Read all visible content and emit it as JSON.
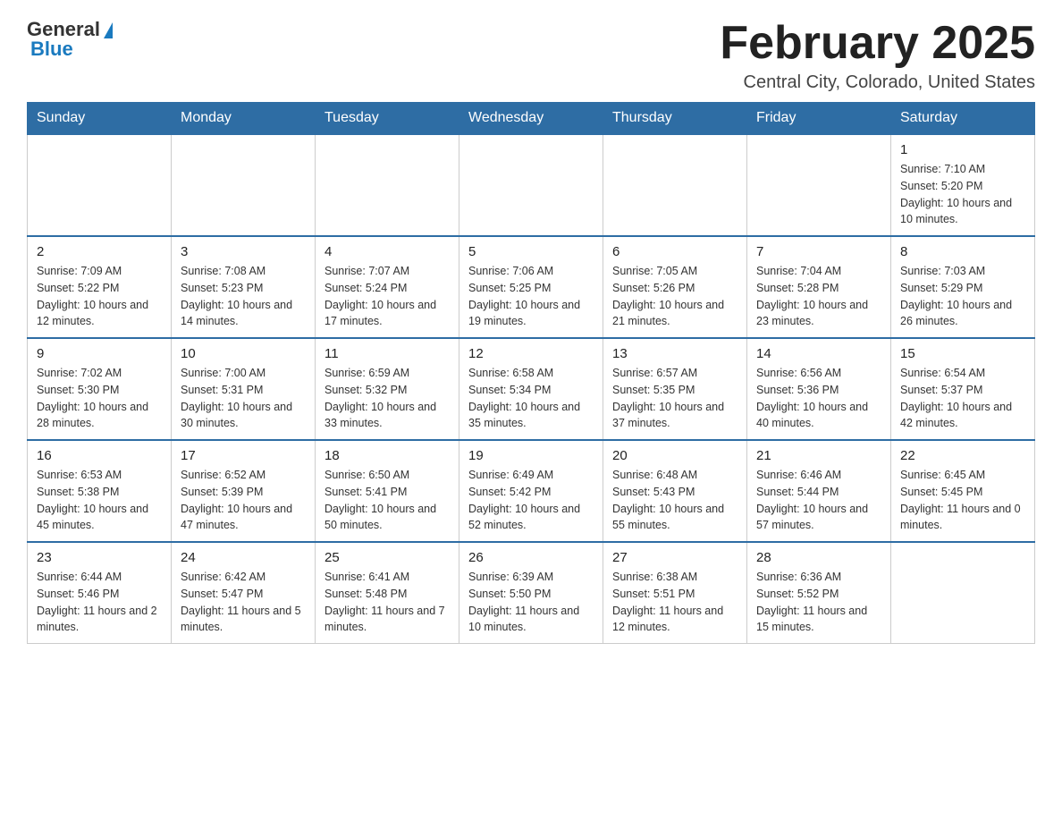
{
  "header": {
    "logo_general": "General",
    "logo_blue": "Blue",
    "month_title": "February 2025",
    "location": "Central City, Colorado, United States"
  },
  "days_of_week": [
    "Sunday",
    "Monday",
    "Tuesday",
    "Wednesday",
    "Thursday",
    "Friday",
    "Saturday"
  ],
  "weeks": [
    [
      {
        "day": "",
        "info": ""
      },
      {
        "day": "",
        "info": ""
      },
      {
        "day": "",
        "info": ""
      },
      {
        "day": "",
        "info": ""
      },
      {
        "day": "",
        "info": ""
      },
      {
        "day": "",
        "info": ""
      },
      {
        "day": "1",
        "info": "Sunrise: 7:10 AM\nSunset: 5:20 PM\nDaylight: 10 hours and 10 minutes."
      }
    ],
    [
      {
        "day": "2",
        "info": "Sunrise: 7:09 AM\nSunset: 5:22 PM\nDaylight: 10 hours and 12 minutes."
      },
      {
        "day": "3",
        "info": "Sunrise: 7:08 AM\nSunset: 5:23 PM\nDaylight: 10 hours and 14 minutes."
      },
      {
        "day": "4",
        "info": "Sunrise: 7:07 AM\nSunset: 5:24 PM\nDaylight: 10 hours and 17 minutes."
      },
      {
        "day": "5",
        "info": "Sunrise: 7:06 AM\nSunset: 5:25 PM\nDaylight: 10 hours and 19 minutes."
      },
      {
        "day": "6",
        "info": "Sunrise: 7:05 AM\nSunset: 5:26 PM\nDaylight: 10 hours and 21 minutes."
      },
      {
        "day": "7",
        "info": "Sunrise: 7:04 AM\nSunset: 5:28 PM\nDaylight: 10 hours and 23 minutes."
      },
      {
        "day": "8",
        "info": "Sunrise: 7:03 AM\nSunset: 5:29 PM\nDaylight: 10 hours and 26 minutes."
      }
    ],
    [
      {
        "day": "9",
        "info": "Sunrise: 7:02 AM\nSunset: 5:30 PM\nDaylight: 10 hours and 28 minutes."
      },
      {
        "day": "10",
        "info": "Sunrise: 7:00 AM\nSunset: 5:31 PM\nDaylight: 10 hours and 30 minutes."
      },
      {
        "day": "11",
        "info": "Sunrise: 6:59 AM\nSunset: 5:32 PM\nDaylight: 10 hours and 33 minutes."
      },
      {
        "day": "12",
        "info": "Sunrise: 6:58 AM\nSunset: 5:34 PM\nDaylight: 10 hours and 35 minutes."
      },
      {
        "day": "13",
        "info": "Sunrise: 6:57 AM\nSunset: 5:35 PM\nDaylight: 10 hours and 37 minutes."
      },
      {
        "day": "14",
        "info": "Sunrise: 6:56 AM\nSunset: 5:36 PM\nDaylight: 10 hours and 40 minutes."
      },
      {
        "day": "15",
        "info": "Sunrise: 6:54 AM\nSunset: 5:37 PM\nDaylight: 10 hours and 42 minutes."
      }
    ],
    [
      {
        "day": "16",
        "info": "Sunrise: 6:53 AM\nSunset: 5:38 PM\nDaylight: 10 hours and 45 minutes."
      },
      {
        "day": "17",
        "info": "Sunrise: 6:52 AM\nSunset: 5:39 PM\nDaylight: 10 hours and 47 minutes."
      },
      {
        "day": "18",
        "info": "Sunrise: 6:50 AM\nSunset: 5:41 PM\nDaylight: 10 hours and 50 minutes."
      },
      {
        "day": "19",
        "info": "Sunrise: 6:49 AM\nSunset: 5:42 PM\nDaylight: 10 hours and 52 minutes."
      },
      {
        "day": "20",
        "info": "Sunrise: 6:48 AM\nSunset: 5:43 PM\nDaylight: 10 hours and 55 minutes."
      },
      {
        "day": "21",
        "info": "Sunrise: 6:46 AM\nSunset: 5:44 PM\nDaylight: 10 hours and 57 minutes."
      },
      {
        "day": "22",
        "info": "Sunrise: 6:45 AM\nSunset: 5:45 PM\nDaylight: 11 hours and 0 minutes."
      }
    ],
    [
      {
        "day": "23",
        "info": "Sunrise: 6:44 AM\nSunset: 5:46 PM\nDaylight: 11 hours and 2 minutes."
      },
      {
        "day": "24",
        "info": "Sunrise: 6:42 AM\nSunset: 5:47 PM\nDaylight: 11 hours and 5 minutes."
      },
      {
        "day": "25",
        "info": "Sunrise: 6:41 AM\nSunset: 5:48 PM\nDaylight: 11 hours and 7 minutes."
      },
      {
        "day": "26",
        "info": "Sunrise: 6:39 AM\nSunset: 5:50 PM\nDaylight: 11 hours and 10 minutes."
      },
      {
        "day": "27",
        "info": "Sunrise: 6:38 AM\nSunset: 5:51 PM\nDaylight: 11 hours and 12 minutes."
      },
      {
        "day": "28",
        "info": "Sunrise: 6:36 AM\nSunset: 5:52 PM\nDaylight: 11 hours and 15 minutes."
      },
      {
        "day": "",
        "info": ""
      }
    ]
  ]
}
